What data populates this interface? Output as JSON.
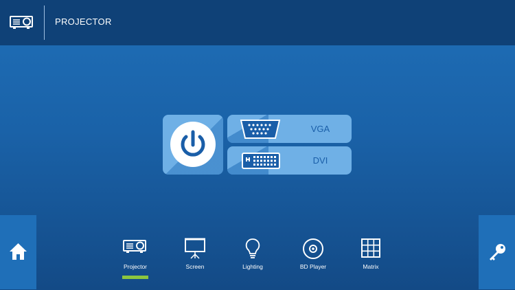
{
  "header": {
    "title": "PROJECTOR",
    "icon": "projector-icon"
  },
  "main": {
    "power_button": {
      "icon": "power-icon"
    },
    "sources": [
      {
        "label": "VGA",
        "icon": "vga-connector-icon"
      },
      {
        "label": "DVI",
        "icon": "dvi-connector-icon"
      }
    ]
  },
  "side": {
    "home_icon": "home-icon",
    "key_icon": "key-icon"
  },
  "nav": {
    "items": [
      {
        "label": "Projector",
        "icon": "projector-icon",
        "active": true
      },
      {
        "label": "Screen",
        "icon": "screen-icon",
        "active": false
      },
      {
        "label": "Lighting",
        "icon": "lightbulb-icon",
        "active": false
      },
      {
        "label": "BD Player",
        "icon": "disc-icon",
        "active": false
      },
      {
        "label": "Matrix",
        "icon": "grid-icon",
        "active": false
      }
    ]
  },
  "colors": {
    "header_bg": "#0f4177",
    "background_top": "#1f6fb8",
    "background_bottom": "#134a86",
    "button_bg": "#6fb0e6",
    "button_text": "#1a5ea8",
    "active_indicator": "#8cc63f"
  }
}
